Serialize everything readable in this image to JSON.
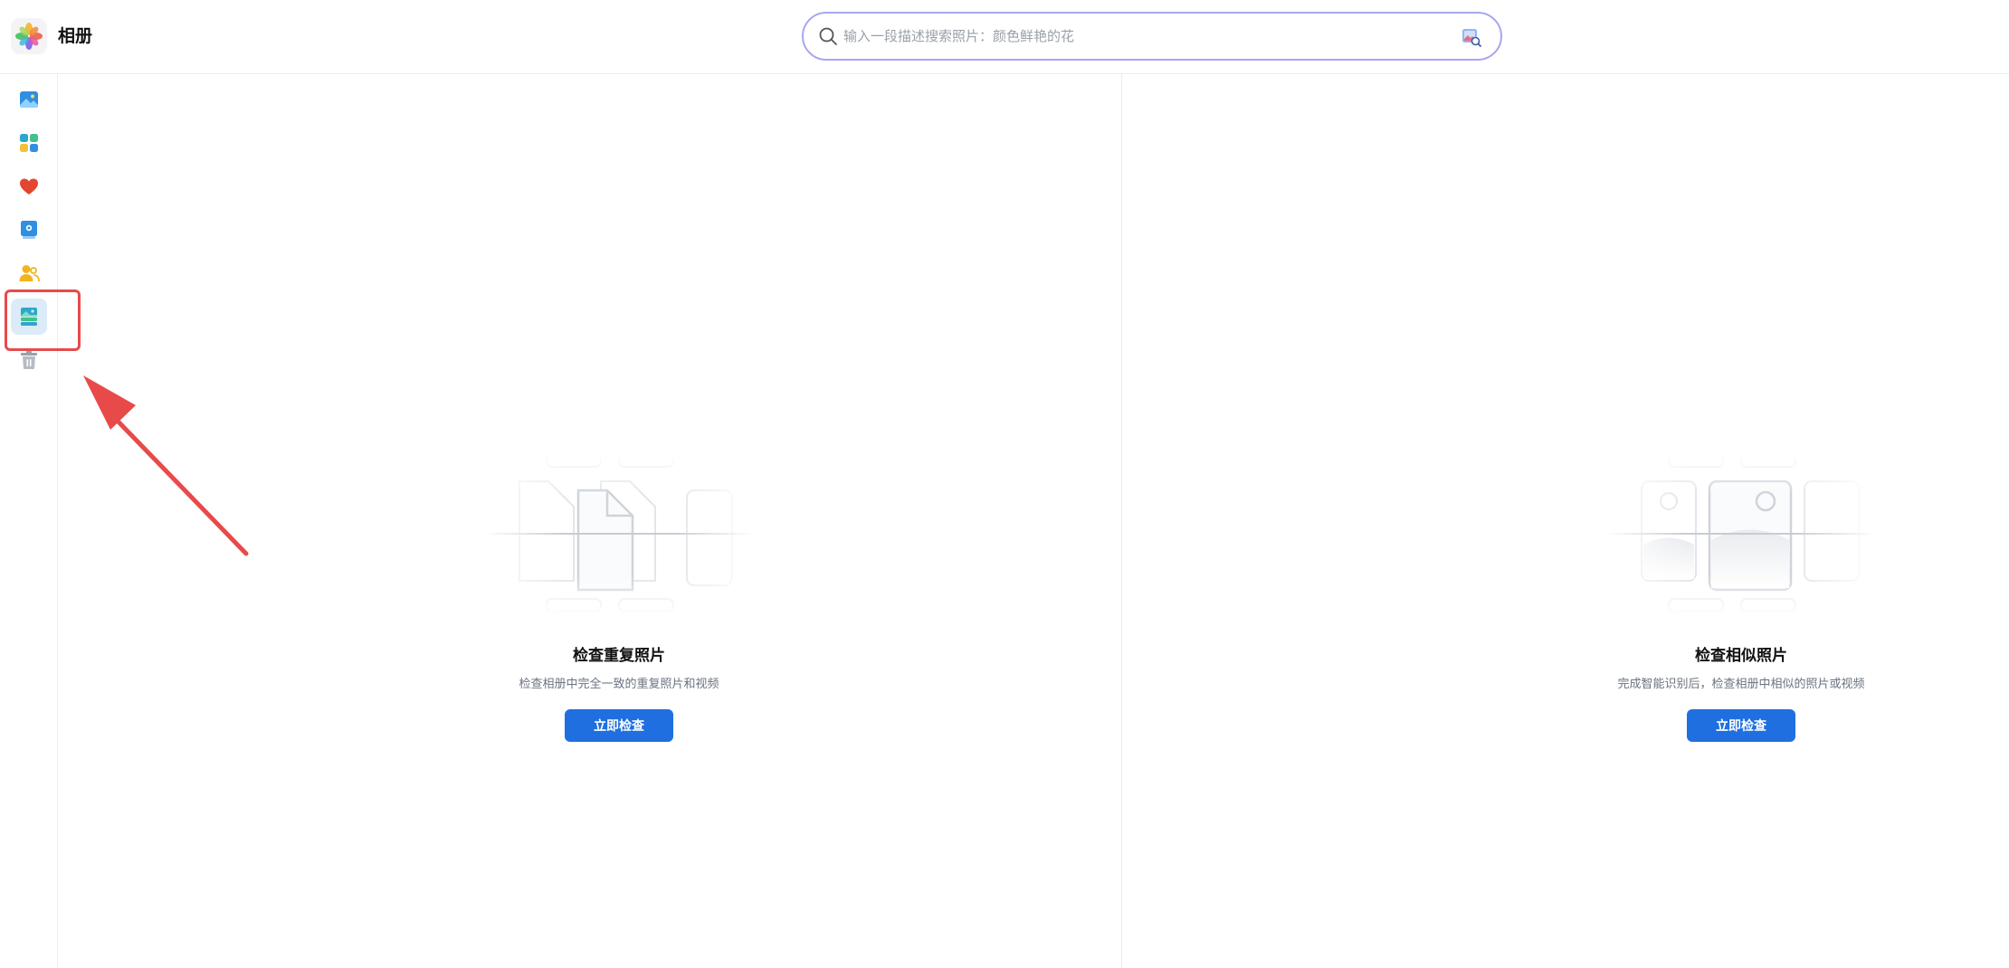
{
  "header": {
    "app_title": "相册",
    "search_placeholder": "输入一段描述搜索照片：颜色鲜艳的花"
  },
  "sidebar": {
    "items": [
      {
        "icon": "photos-icon",
        "active": false
      },
      {
        "icon": "albums-icon",
        "active": false
      },
      {
        "icon": "favorites-heart-icon",
        "active": false
      },
      {
        "icon": "memories-book-icon",
        "active": false
      },
      {
        "icon": "people-icon",
        "active": false
      },
      {
        "icon": "duplicate-cleanup-icon",
        "active": true
      },
      {
        "icon": "trash-icon",
        "active": false
      }
    ]
  },
  "panels": {
    "duplicates": {
      "title": "检查重复照片",
      "description": "检查相册中完全一致的重复照片和视频",
      "button_label": "立即检查"
    },
    "similar": {
      "title": "检查相似照片",
      "description": "完成智能识别后，检查相册中相似的照片或视频",
      "button_label": "立即检查"
    }
  },
  "colors": {
    "accent": "#1f6fe0",
    "search_border": "#a9a6f0",
    "annotation_red": "#e84a4a"
  }
}
